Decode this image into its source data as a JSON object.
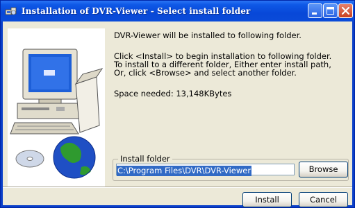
{
  "window": {
    "title": "Installation of DVR-Viewer - Select install folder"
  },
  "body": {
    "line1": "DVR-Viewer will be installed to following folder.",
    "para1": "Click <Install> to begin installation to following folder.",
    "para2": "To install to a different folder, Either enter install path,",
    "para3": "Or, click <Browse> and select another folder.",
    "space_needed": "Space needed: 13,148KBytes"
  },
  "install_folder": {
    "label": "Install folder",
    "path_value": "C:\\Program Files\\DVR\\DVR-Viewer",
    "browse_label": "Browse"
  },
  "buttons": {
    "install_label": "Install",
    "cancel_label": "Cancel"
  },
  "icons": {
    "app": "installer-icon",
    "minimize": "minimize-icon",
    "maximize": "maximize-icon",
    "close": "close-icon"
  },
  "colors": {
    "titlebar": "#0a4bd9",
    "client": "#ece9d8",
    "selection": "#316ac5",
    "close_button": "#c8401f"
  }
}
